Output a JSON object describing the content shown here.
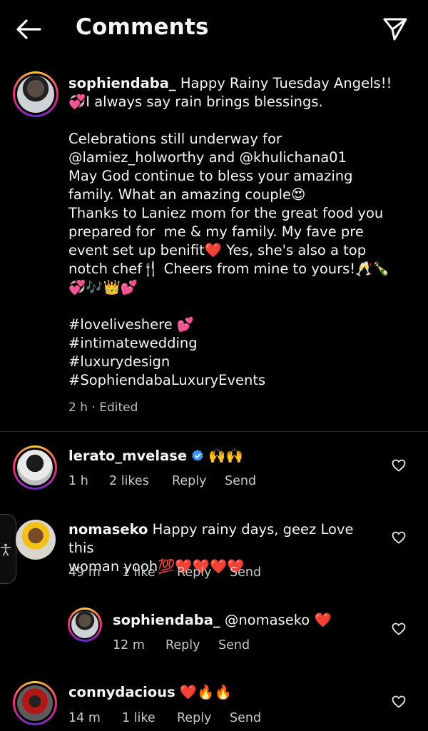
{
  "header": {
    "title": "Comments",
    "back_icon": "back-arrow-icon",
    "send_icon": "paper-plane-icon"
  },
  "post": {
    "username": "sophiendaba_",
    "caption": " Happy Rainy Tuesday Angels!!\n💞I always say rain brings blessings.\n\nCelebrations still underway for\n@lamiez_holworthy and @khulichana01\nMay God continue to bless your amazing\nfamily. What an amazing couple😍\nThanks to Laniez mom for the great food you\nprepared for  me & my family. My fave pre\nevent set up benifit❤️ Yes, she's also a top\nnotch chef🍴 Cheers from mine to yours!🥂🍾\n💞🎶👑💕\n\n#loveliveshere 💕\n#intimatewedding\n#luxurydesign\n#SophiendabaLuxuryEvents",
    "time": "2 h · Edited"
  },
  "comments": [
    {
      "username": "lerato_mvelase",
      "verified": true,
      "text": " 🙌🙌",
      "time": "1 h",
      "likes": "2 likes",
      "reply": "Reply",
      "send": "Send"
    },
    {
      "username": "nomaseko",
      "text": " Happy rainy days, geez Love this\nwoman yooh💯❤️❤️❤️❤️",
      "time": "49 m",
      "likes": "1 like",
      "reply": "Reply",
      "send": "Send"
    },
    {
      "username": "sophiendaba_",
      "text": " @nomaseko ❤️",
      "time": "12 m",
      "reply": "Reply",
      "send": "Send"
    },
    {
      "username": "connydacious",
      "text": " ❤️🔥🔥",
      "time": "14 m",
      "likes": "1 like",
      "reply": "Reply",
      "send": "Send"
    }
  ],
  "colors": {
    "background": "#000000",
    "text": "#f5f5f5",
    "meta": "#c8c8c8",
    "verified": "#3897f0"
  }
}
